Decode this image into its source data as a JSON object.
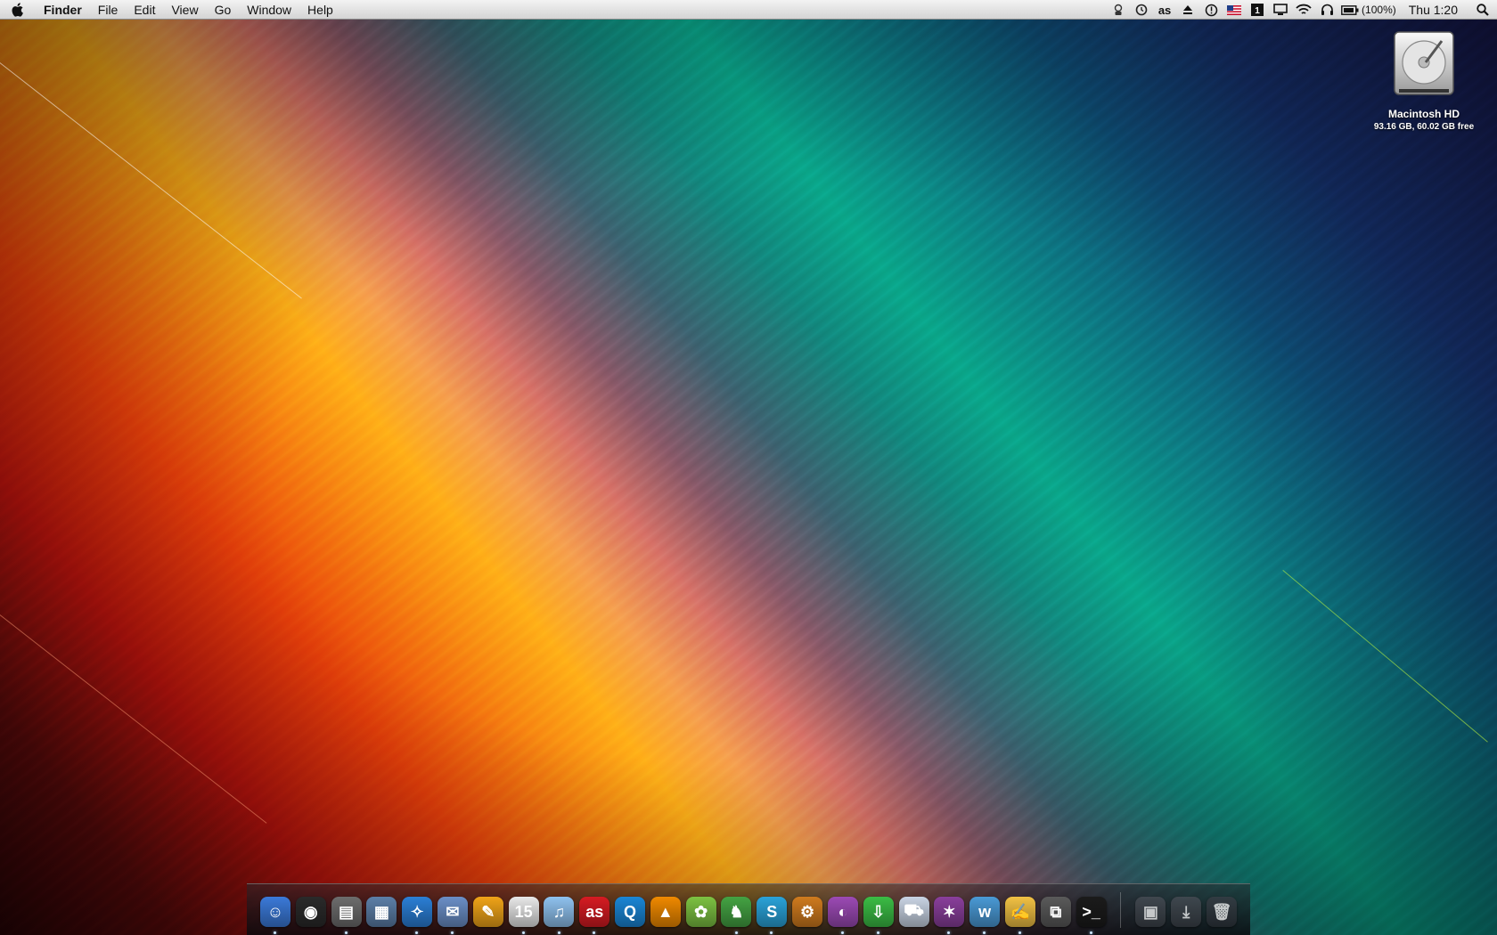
{
  "menubar": {
    "apple_icon": "apple-logo-icon",
    "items": [
      "Finder",
      "File",
      "Edit",
      "View",
      "Go",
      "Window",
      "Help"
    ],
    "status": {
      "icons": [
        "user-icon",
        "time-machine-icon",
        "lastfm-icon",
        "eject-icon",
        "history-icon",
        "us-flag-icon",
        "spaces-icon",
        "display-icon",
        "wifi-icon",
        "headphones-icon",
        "battery-icon"
      ],
      "battery": "(100%)",
      "clock": "Thu 1:20",
      "spotlight": "spotlight-icon"
    }
  },
  "desktop": {
    "drive": {
      "name": "Macintosh HD",
      "info": "93.16 GB, 60.02 GB free"
    }
  },
  "dock": {
    "apps": [
      {
        "name": "finder",
        "glyph": "☺",
        "color": "#3b7ad9",
        "running": true
      },
      {
        "name": "dashboard",
        "glyph": "◉",
        "color": "#2a2a2a",
        "running": false
      },
      {
        "name": "iphoto",
        "glyph": "▤",
        "color": "#6d6d6d",
        "running": true
      },
      {
        "name": "mission-control",
        "glyph": "▦",
        "color": "#5c7fa8",
        "running": false
      },
      {
        "name": "safari",
        "glyph": "✧",
        "color": "#2b7fd6",
        "running": true
      },
      {
        "name": "mail",
        "glyph": "✉",
        "color": "#6b8fc7",
        "running": true
      },
      {
        "name": "pixelmator",
        "glyph": "✎",
        "color": "#f0a418",
        "running": false
      },
      {
        "name": "ical",
        "glyph": "15",
        "color": "#e8e8e8",
        "running": true
      },
      {
        "name": "itunes",
        "glyph": "♫",
        "color": "#8fc2ef",
        "running": true
      },
      {
        "name": "lastfm",
        "glyph": "as",
        "color": "#d61b22",
        "running": true
      },
      {
        "name": "quicktime",
        "glyph": "Q",
        "color": "#1a86d6",
        "running": false
      },
      {
        "name": "vlc",
        "glyph": "▲",
        "color": "#f08a00",
        "running": false
      },
      {
        "name": "adium",
        "glyph": "✿",
        "color": "#7dc242",
        "running": false
      },
      {
        "name": "cyberduck",
        "glyph": "♞",
        "color": "#44a343",
        "running": true
      },
      {
        "name": "skype",
        "glyph": "S",
        "color": "#2aa3d9",
        "running": true
      },
      {
        "name": "transmission",
        "glyph": "⚙",
        "color": "#d07b1e",
        "running": false
      },
      {
        "name": "opera",
        "glyph": "◐",
        "color": "#9c4ab5",
        "running": true
      },
      {
        "name": "downloader",
        "glyph": "⇩",
        "color": "#3bbd45",
        "running": true
      },
      {
        "name": "transmit",
        "glyph": "⛟",
        "color": "#c9d4e4",
        "running": false
      },
      {
        "name": "photoshop",
        "glyph": "✶",
        "color": "#8a3f9c",
        "running": true
      },
      {
        "name": "textwrangler",
        "glyph": "w",
        "color": "#4a9ad6",
        "running": true
      },
      {
        "name": "pages",
        "glyph": "✍",
        "color": "#f2c244",
        "running": true
      },
      {
        "name": "vmware",
        "glyph": "⧉",
        "color": "#5a5a5a",
        "running": false
      },
      {
        "name": "terminal",
        "glyph": ">_",
        "color": "#1b1b1b",
        "running": true
      }
    ],
    "stacks": [
      {
        "name": "documents-stack",
        "glyph": "▣",
        "color": "#4a4f57"
      },
      {
        "name": "downloads-stack",
        "glyph": "⤓",
        "color": "#4a4f57"
      },
      {
        "name": "trash",
        "glyph": "🗑",
        "color": "#3a3f47"
      }
    ]
  }
}
